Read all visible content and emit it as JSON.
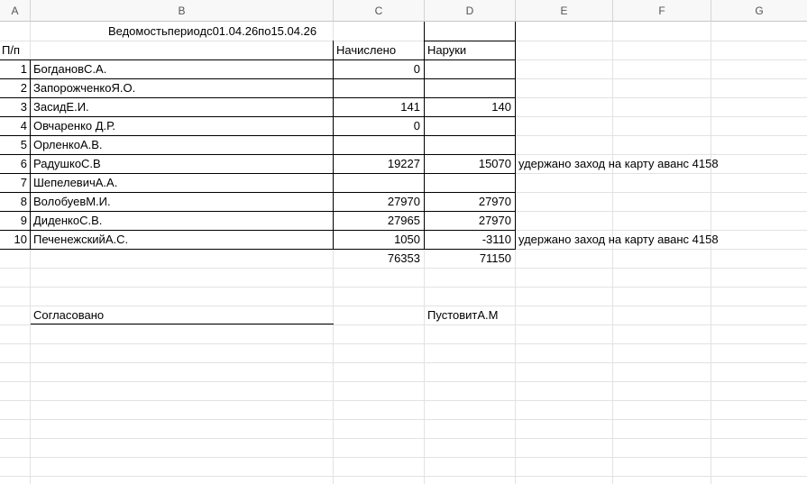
{
  "columns": [
    "A",
    "B",
    "C",
    "D",
    "E",
    "F",
    "G"
  ],
  "title": "Ведомостьпериодс01.04.26по15.04.26",
  "headers": {
    "num": "П/п",
    "accrued": "Начислено",
    "cash": "Наруки"
  },
  "rows": [
    {
      "num": "1",
      "name": "БогдановС.А.",
      "accrued": "0",
      "cash": "",
      "note": ""
    },
    {
      "num": "2",
      "name": "ЗапорожченкоЯ.О.",
      "accrued": "",
      "cash": "",
      "note": ""
    },
    {
      "num": "3",
      "name": "ЗасидЕ.И.",
      "accrued": "141",
      "cash": "140",
      "note": ""
    },
    {
      "num": "4",
      "name": "Овчаренко Д.Р.",
      "accrued": "0",
      "cash": "",
      "note": ""
    },
    {
      "num": "5",
      "name": "ОрленкоА.В.",
      "accrued": "",
      "cash": "",
      "note": ""
    },
    {
      "num": "6",
      "name": "РадушкоС.В",
      "accrued": "19227",
      "cash": "15070",
      "note": "удержано  заход на карту аванс 4158"
    },
    {
      "num": "7",
      "name": "ШепелевичА.А.",
      "accrued": "",
      "cash": "",
      "note": ""
    },
    {
      "num": "8",
      "name": "ВолобуевМ.И.",
      "accrued": "27970",
      "cash": "27970",
      "note": ""
    },
    {
      "num": "9",
      "name": "ДиденкоС.В.",
      "accrued": "27965",
      "cash": "27970",
      "note": ""
    },
    {
      "num": "10",
      "name": "ПеченежскийА.С.",
      "accrued": "1050",
      "cash": "-3110",
      "note": "удержано  заход на карту аванс 4158"
    }
  ],
  "totals": {
    "accrued": "76353",
    "cash": "71150"
  },
  "footer": {
    "approved": "Согласовано",
    "signer": "ПустовитА.М"
  }
}
